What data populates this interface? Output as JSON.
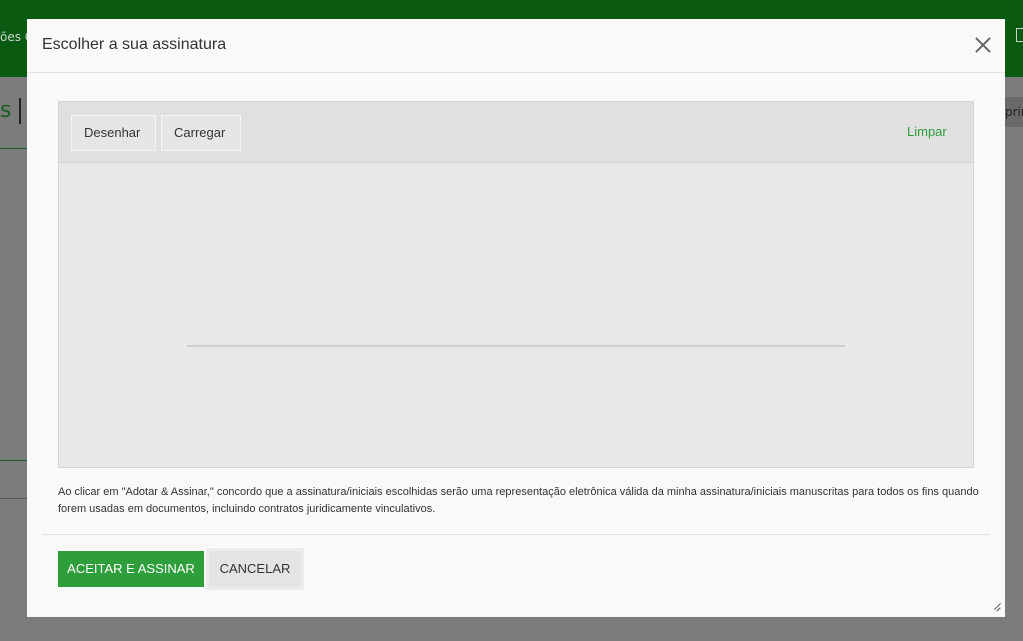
{
  "background": {
    "topbar_left_text": "ões G",
    "title_text": "s",
    "right_tab_text": "prin"
  },
  "modal": {
    "title": "Escolher a sua assinatura",
    "tabs": [
      {
        "label": "Desenhar"
      },
      {
        "label": "Carregar"
      }
    ],
    "clear_label": "Limpar",
    "disclaimer": "Ao clicar em \"Adotar & Assinar,\" concordo que a assinatura/iniciais escolhidas serão uma representação eletrônica válida da minha assinatura/iniciais manuscritas para todos os fins quando forem usadas em documentos, incluindo contratos juridicamente vinculativos.",
    "accept_label": "ACEITAR E ASSINAR",
    "cancel_label": "CANCELAR"
  },
  "colors": {
    "topbar": "#0b5a12",
    "accent": "#2e9e3b",
    "overlay": "#7c7c7c"
  },
  "icons": {
    "close": "close-icon",
    "resize": "resize-handle-icon"
  }
}
